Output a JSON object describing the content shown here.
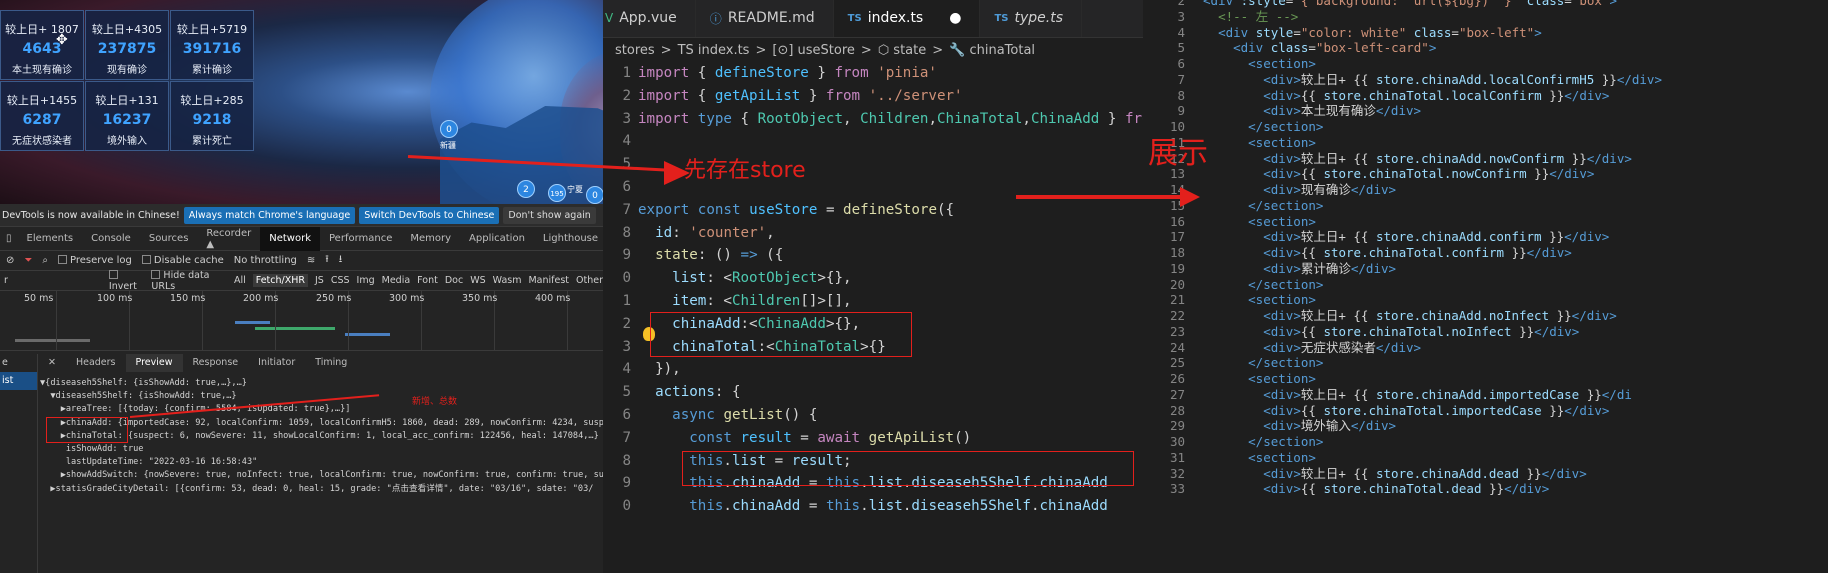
{
  "dashboard": {
    "cards": [
      {
        "delta": "较上日+ 1807",
        "value": "4643",
        "label": "本土现有确诊"
      },
      {
        "delta": "较上日+4305",
        "value": "237875",
        "label": "现有确诊"
      },
      {
        "delta": "较上日+5719",
        "value": "391716",
        "label": "累计确诊"
      },
      {
        "delta": "较上日+1455",
        "value": "6287",
        "label": "无症状感染者"
      },
      {
        "delta": "较上日+131",
        "value": "16237",
        "label": "境外输入"
      },
      {
        "delta": "较上日+285",
        "value": "9218",
        "label": "累计死亡"
      }
    ],
    "map_pins": [
      {
        "count": "0",
        "label": "新疆"
      },
      {
        "count": "2",
        "label": ""
      },
      {
        "count": "195",
        "label": "宁夏"
      },
      {
        "count": "0",
        "label": ""
      }
    ],
    "move_icon": "move-cursor-icon"
  },
  "devtools": {
    "infobar": {
      "message": "DevTools is now available in Chinese!",
      "btn_match": "Always match Chrome's language",
      "btn_switch": "Switch DevTools to Chinese",
      "btn_dismiss": "Don't show again"
    },
    "tabs": [
      "Elements",
      "Console",
      "Sources",
      "Recorder ▲",
      "Network",
      "Performance",
      "Memory",
      "Application",
      "Lighthouse",
      "Vue"
    ],
    "active_tab": "Network",
    "toolbar1": {
      "preserve_log": "Preserve log",
      "disable_cache": "Disable cache",
      "throttling": "No throttling"
    },
    "toolbar2": {
      "filter_prefix": "r",
      "invert": "Invert",
      "hide_data_urls": "Hide data URLs",
      "types": [
        "All",
        "Fetch/XHR",
        "JS",
        "CSS",
        "Img",
        "Media",
        "Font",
        "Doc",
        "WS",
        "Wasm",
        "Manifest",
        "Other"
      ],
      "selected_type": "Fetch/XHR"
    },
    "timeline_ticks": [
      "50 ms",
      "100 ms",
      "150 ms",
      "200 ms",
      "250 ms",
      "300 ms",
      "350 ms",
      "400 ms"
    ],
    "side_items": [
      "e",
      "ist"
    ],
    "panel_tabs": [
      "Headers",
      "Preview",
      "Response",
      "Initiator",
      "Timing"
    ],
    "active_panel_tab": "Preview",
    "tree": [
      "▼{diseaseh5Shelf: {isShowAdd: true,…},…}",
      "  ▼diseaseh5Shelf: {isShowAdd: true,…}",
      "    ▶areaTree: [{today: {confirm: 5584, isUpdated: true},…}]",
      "    ▶chinaAdd: {importedCase: 92, localConfirm: 1059, localConfirmH5: 1860, dead: 289, nowConfirm: 4234, susp",
      "    ▶chinaTotal: {suspect: 6, nowSevere: 11, showLocalConfirm: 1, local_acc_confirm: 122456, heal: 147084,…}",
      "     isShowAdd: true",
      "     lastUpdateTime: \"2022-03-16 16:58:43\"",
      "    ▶showAddSwitch: {nowSevere: true, noInfect: true, localConfirm: true, nowConfirm: true, confirm: true, su",
      "  ▶statisGradeCityDetail: [{confirm: 53, dead: 0, heal: 15, grade: \"点击查看详情\", date: \"03/16\", sdate: \"03/"
    ],
    "note": "新增、总数"
  },
  "editor": {
    "tabs": [
      {
        "icon": "vue-icon",
        "label": "App.vue",
        "active": false
      },
      {
        "icon": "info-icon",
        "label": "README.md",
        "active": false
      },
      {
        "icon": "ts-icon",
        "label": "index.ts",
        "active": true,
        "dirty": "●"
      },
      {
        "icon": "ts-icon",
        "label": "type.ts",
        "active": false
      }
    ],
    "breadcrumbs": [
      "stores",
      ">",
      "TS index.ts",
      ">",
      "[⊙] useStore",
      ">",
      "⬡ state",
      ">",
      "🔧 chinaTotal"
    ],
    "annotation": "先存在store",
    "lines": [
      {
        "n": "1",
        "html": "<span class='kw'>import</span> { <span class='vr'>defineStore</span> } <span class='kw'>from</span> <span class='st'>'pinia'</span>"
      },
      {
        "n": "2",
        "html": "<span class='kw'>import</span> { <span class='vr'>getApiList</span> } <span class='kw'>from</span> <span class='st'>'../server'</span>"
      },
      {
        "n": "3",
        "html": "<span class='kw'>import</span> <span class='kwb'>type</span> { <span class='ty'>RootObject</span>, <span class='ty'>Children</span>,<span class='ty'>ChinaTotal</span>,<span class='ty'>ChinaAdd</span> } <span class='kw'>from</span>"
      },
      {
        "n": "4",
        "html": ""
      },
      {
        "n": "5",
        "html": ""
      },
      {
        "n": "6",
        "html": ""
      },
      {
        "n": "7",
        "html": "<span class='kwb'>export</span> <span class='kwb'>const</span> <span class='vr'>useStore</span> = <span class='fn'>defineStore</span>({"
      },
      {
        "n": "8",
        "html": "  <span class='pr'>id</span>: <span class='st'>'counter'</span>,"
      },
      {
        "n": "9",
        "html": "  <span class='fn'>state</span>: () <span class='kwb'>=&gt;</span> ({"
      },
      {
        "n": "0",
        "html": "    <span class='pr'>list</span>: &lt;<span class='ty'>RootObject</span>&gt;{},"
      },
      {
        "n": "1",
        "html": "    <span class='pr'>item</span>: &lt;<span class='ty'>Children</span>[]&gt;[],"
      },
      {
        "n": "2",
        "html": "    <span class='pr'>chinaAdd</span>:&lt;<span class='ty'>ChinaAdd</span>&gt;{},"
      },
      {
        "n": "3",
        "html": "    <span class='pr'>chinaTotal</span>:&lt;<span class='ty'>ChinaTotal</span>&gt;{}"
      },
      {
        "n": "4",
        "html": "  }),"
      },
      {
        "n": "5",
        "html": "  <span class='pr'>actions</span>: {"
      },
      {
        "n": "6",
        "html": "    <span class='kwb'>async</span> <span class='fn'>getList</span>() {"
      },
      {
        "n": "7",
        "html": "      <span class='kwb'>const</span> <span class='vr'>result</span> = <span class='kw'>await</span> <span class='fn'>getApiList</span>()"
      },
      {
        "n": "8",
        "html": "      <span class='kwb'>this</span>.<span class='pr'>list</span> = <span class='pr'>result</span>;"
      },
      {
        "n": "9",
        "html": "      <span class='kwb'>this</span>.<span class='pr'>chinaAdd</span> = <span class='kwb'>this</span>.<span class='pr'>list</span>.<span class='pr'>diseaseh5Shelf</span>.<span class='pr'>chinaAdd</span>"
      },
      {
        "n": "0",
        "html": "      <span class='kwb'>this</span>.<span class='pr'>chinaAdd</span> = <span class='kwb'>this</span>.<span class='pr'>list</span>.<span class='pr'>diseaseh5Shelf</span>.<span class='pr'>chinaAdd</span>"
      }
    ]
  },
  "right_code": {
    "annotation": "展示",
    "lines": [
      {
        "n": "2",
        "html": "<span class='tg'>&lt;div</span> <span class='at'>:style</span>=<span class='av'>\"{ background: `url(${bg})` }\"</span> <span class='at'>class</span>=<span class='av'>\"box\"</span><span class='tg'>&gt;</span>"
      },
      {
        "n": "3",
        "html": "  <span class='cm'>&lt;!-- 左 --&gt;</span>"
      },
      {
        "n": "4",
        "html": "  <span class='tg'>&lt;div</span> <span class='at'>style</span>=<span class='av'>\"color: white\"</span> <span class='at'>class</span>=<span class='av'>\"box-left\"</span><span class='tg'>&gt;</span>"
      },
      {
        "n": "5",
        "html": "    <span class='tg'>&lt;div</span> <span class='at'>class</span>=<span class='av'>\"box-left-card\"</span><span class='tg'>&gt;</span>"
      },
      {
        "n": "6",
        "html": "      <span class='tg'>&lt;section&gt;</span>"
      },
      {
        "n": "7",
        "html": "        <span class='tg'>&lt;div&gt;</span>较上日+ {{ <span class='at'>store.chinaAdd.localConfirmH5</span> }}<span class='tg'>&lt;/div&gt;</span>"
      },
      {
        "n": "8",
        "html": "        <span class='tg'>&lt;div&gt;</span>{{ <span class='at'>store.chinaTotal.localConfirm</span> }}<span class='tg'>&lt;/div&gt;</span>"
      },
      {
        "n": "9",
        "html": "        <span class='tg'>&lt;div&gt;</span>本土现有确诊<span class='tg'>&lt;/div&gt;</span>"
      },
      {
        "n": "10",
        "html": "      <span class='tg'>&lt;/section&gt;</span>"
      },
      {
        "n": "11",
        "html": "      <span class='tg'>&lt;section&gt;</span>"
      },
      {
        "n": "12",
        "html": "        <span class='tg'>&lt;div&gt;</span>较上日+ {{ <span class='at'>store.chinaAdd.nowConfirm</span> }}<span class='tg'>&lt;/div&gt;</span>"
      },
      {
        "n": "13",
        "html": "        <span class='tg'>&lt;div&gt;</span>{{ <span class='at'>store.chinaTotal.nowConfirm</span> }}<span class='tg'>&lt;/div&gt;</span>"
      },
      {
        "n": "14",
        "html": "        <span class='tg'>&lt;div&gt;</span>现有确诊<span class='tg'>&lt;/div&gt;</span>"
      },
      {
        "n": "15",
        "html": "      <span class='tg'>&lt;/section&gt;</span>"
      },
      {
        "n": "16",
        "html": "      <span class='tg'>&lt;section&gt;</span>"
      },
      {
        "n": "17",
        "html": "        <span class='tg'>&lt;div&gt;</span>较上日+ {{ <span class='at'>store.chinaAdd.confirm</span> }}<span class='tg'>&lt;/div&gt;</span>"
      },
      {
        "n": "18",
        "html": "        <span class='tg'>&lt;div&gt;</span>{{ <span class='at'>store.chinaTotal.confirm</span> }}<span class='tg'>&lt;/div&gt;</span>"
      },
      {
        "n": "19",
        "html": "        <span class='tg'>&lt;div&gt;</span>累计确诊<span class='tg'>&lt;/div&gt;</span>"
      },
      {
        "n": "20",
        "html": "      <span class='tg'>&lt;/section&gt;</span>"
      },
      {
        "n": "21",
        "html": "      <span class='tg'>&lt;section&gt;</span>"
      },
      {
        "n": "22",
        "html": "        <span class='tg'>&lt;div&gt;</span>较上日+ {{ <span class='at'>store.chinaAdd.noInfect</span> }}<span class='tg'>&lt;/div&gt;</span>"
      },
      {
        "n": "23",
        "html": "        <span class='tg'>&lt;div&gt;</span>{{ <span class='at'>store.chinaTotal.noInfect</span> }}<span class='tg'>&lt;/div&gt;</span>"
      },
      {
        "n": "24",
        "html": "        <span class='tg'>&lt;div&gt;</span>无症状感染者<span class='tg'>&lt;/div&gt;</span>"
      },
      {
        "n": "25",
        "html": "      <span class='tg'>&lt;/section&gt;</span>"
      },
      {
        "n": "26",
        "html": "      <span class='tg'>&lt;section&gt;</span>"
      },
      {
        "n": "27",
        "html": "        <span class='tg'>&lt;div&gt;</span>较上日+ {{ <span class='at'>store.chinaAdd.importedCase</span> }}<span class='tg'>&lt;/di</span>"
      },
      {
        "n": "28",
        "html": "        <span class='tg'>&lt;div&gt;</span>{{ <span class='at'>store.chinaTotal.importedCase</span> }}<span class='tg'>&lt;/div&gt;</span>"
      },
      {
        "n": "29",
        "html": "        <span class='tg'>&lt;div&gt;</span>境外输入<span class='tg'>&lt;/div&gt;</span>"
      },
      {
        "n": "30",
        "html": "      <span class='tg'>&lt;/section&gt;</span>"
      },
      {
        "n": "31",
        "html": "      <span class='tg'>&lt;section&gt;</span>"
      },
      {
        "n": "32",
        "html": "        <span class='tg'>&lt;div&gt;</span>较上日+ {{ <span class='at'>store.chinaAdd.dead</span> }}<span class='tg'>&lt;/div&gt;</span>"
      },
      {
        "n": "33",
        "html": "        <span class='tg'>&lt;div&gt;</span>{{ <span class='at'>store.chinaTotal.dead</span> }}<span class='tg'>&lt;/div&gt;</span>"
      }
    ]
  },
  "colors": {
    "annotation_red": "#e3201c",
    "card_value_blue": "#3fa3ff",
    "devtools_blue": "#1a6fb5"
  }
}
